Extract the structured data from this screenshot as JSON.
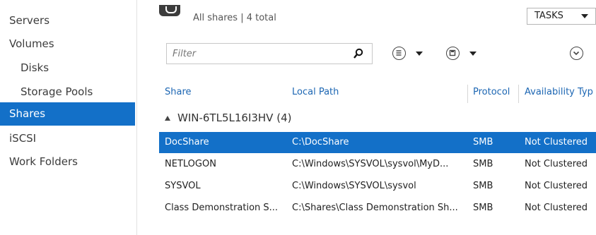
{
  "sidebar": {
    "items": [
      {
        "label": "Servers",
        "level": 0,
        "active": false
      },
      {
        "label": "Volumes",
        "level": 0,
        "active": false
      },
      {
        "label": "Disks",
        "level": 1,
        "active": false
      },
      {
        "label": "Storage Pools",
        "level": 1,
        "active": false
      },
      {
        "label": "Shares",
        "level": 0,
        "active": true
      },
      {
        "label": "iSCSI",
        "level": 0,
        "active": false
      },
      {
        "label": "Work Folders",
        "level": 0,
        "active": false
      }
    ]
  },
  "header": {
    "summary": "All shares | 4 total",
    "tasks_label": "TASKS"
  },
  "filter": {
    "placeholder": "Filter"
  },
  "icons": {
    "search": "search-icon",
    "list_view": "list-view-icon",
    "save": "save-icon",
    "expand": "chevron-down-circle-icon"
  },
  "table": {
    "columns": [
      "Share",
      "Local Path",
      "Protocol",
      "Availability Typ"
    ],
    "group": "WIN-6TL5L16I3HV (4)",
    "rows": [
      {
        "share": "DocShare",
        "path": "C:\\DocShare",
        "protocol": "SMB",
        "availability": "Not Clustered",
        "selected": true
      },
      {
        "share": "NETLOGON",
        "path": "C:\\Windows\\SYSVOL\\sysvol\\MyD...",
        "protocol": "SMB",
        "availability": "Not Clustered",
        "selected": false
      },
      {
        "share": "SYSVOL",
        "path": "C:\\Windows\\SYSVOL\\sysvol",
        "protocol": "SMB",
        "availability": "Not Clustered",
        "selected": false
      },
      {
        "share": "Class Demonstration S...",
        "path": "C:\\Shares\\Class Demonstration Sh...",
        "protocol": "SMB",
        "availability": "Not Clustered",
        "selected": false
      }
    ]
  },
  "colors": {
    "accent": "#1370c8",
    "header_link": "#1c66b3"
  }
}
